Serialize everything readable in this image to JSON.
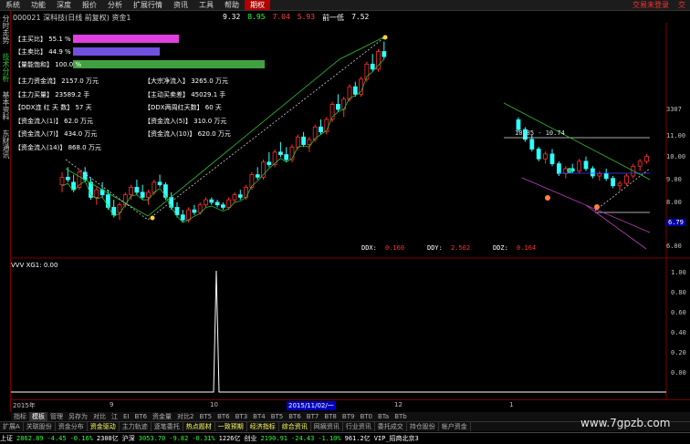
{
  "menu": {
    "items": [
      "系统",
      "功能",
      "深度",
      "报价",
      "分析",
      "扩展行情",
      "资讯",
      "工具",
      "帮助",
      "期权"
    ],
    "active_index": 9,
    "right": [
      "交易未登录",
      "交"
    ]
  },
  "sidebar": {
    "tabs": [
      "分时走势",
      "技术分析",
      "基本资料",
      "东财通讯"
    ],
    "active_index": 1
  },
  "title": {
    "code_name": "000021 深科技(日线 前复权) 资金1",
    "vals": [
      {
        "text": "9.32",
        "color": "#ffffff"
      },
      {
        "text": "8.95",
        "color": "#30ff30"
      },
      {
        "text": "7.04",
        "color": "#ff4040"
      },
      {
        "text": "5.93",
        "color": "#ff4040"
      },
      {
        "text": "前一低",
        "color": "#ffffff"
      },
      {
        "text": "7.52",
        "color": "#ffffff"
      }
    ]
  },
  "flow_bars": [
    {
      "label": "【主买比】 55.1 %",
      "color": "#e040e0",
      "pct": 0.55
    },
    {
      "label": "【主卖比】 44.9 %",
      "color": "#7050e0",
      "pct": 0.45
    },
    {
      "label": "【量能饱和】 100.0 %",
      "color": "#40a040",
      "pct": 1.0
    }
  ],
  "flow_info": [
    [
      "【主力资金流】 2157.0 万元",
      "【大宗净流入】 3265.0 万元"
    ],
    [
      "【主力买量】 23589.2 手",
      "【主动买卖差】 45029.1 手"
    ],
    [
      "【DDX连 红 天 数】 57 天",
      "【DDX两周红天数】 60 天"
    ],
    [
      "【资金流入(1)】 62.0 万元",
      "【资金流入(5)】 310.0 万元"
    ],
    [
      "【资金流入(7)】 434.0 万元",
      "【资金流入(10)】 620.0 万元"
    ],
    [
      "【资金流入(14)】 868.0 万元",
      ""
    ]
  ],
  "price_axis": [
    {
      "text": "3307",
      "hl": false
    },
    {
      "text": "11.00",
      "hl": false
    },
    {
      "text": "10.00",
      "hl": false
    },
    {
      "text": "9.00",
      "hl": false
    },
    {
      "text": "8.00",
      "hl": false
    },
    {
      "text": "6.79",
      "hl": true
    },
    {
      "text": "6.00",
      "hl": false
    }
  ],
  "range_label": "10.85 - 10.74",
  "ddx": [
    {
      "label": "DDX:",
      "value": "0.160"
    },
    {
      "label": "DDY:",
      "value": "2.502"
    },
    {
      "label": "DDZ:",
      "value": "0.164"
    }
  ],
  "indicator": {
    "title": "VVV XG1: 0.00",
    "axis": [
      "1.00",
      "0.80",
      "0.60",
      "0.40",
      "0.20",
      "0.00"
    ]
  },
  "datebar": {
    "year": "2015年",
    "m1": "9",
    "m2": "10",
    "cursor": "2015/11/02/一",
    "m3": "12",
    "m4": "1"
  },
  "tabs1": [
    "指标",
    "模板",
    "管理",
    "另存为",
    "对比",
    "江",
    "EI",
    "BT6",
    "资金量",
    "对比2",
    "BT5",
    "BT6",
    "BT3",
    "BT4",
    "BT5",
    "BT6",
    "BT7",
    "BT8",
    "BT9",
    "BT0",
    "BTa",
    "BTb"
  ],
  "tabs1_sel": 1,
  "tabs2": [
    "扩展A",
    "关联股份",
    "资金分布",
    "资金驱动",
    "主力轨迹",
    "逐笔委托",
    "热点题材",
    "一致预期",
    "经济指标",
    "综合资讯",
    "网摘资讯",
    "行业资讯",
    "委托成交",
    "持仓股份",
    "帐户资金"
  ],
  "tabs2_sel": [
    3,
    6,
    7,
    8,
    9
  ],
  "status": [
    {
      "text": "上证",
      "color": "#ffffff"
    },
    {
      "text": "2862.89",
      "color": "#30ff30"
    },
    {
      "text": "-4.45",
      "color": "#30ff30"
    },
    {
      "text": "-0.16%",
      "color": "#30ff30"
    },
    {
      "text": "2308亿",
      "color": "#ffffff"
    },
    {
      "text": "沪深",
      "color": "#ffffff"
    },
    {
      "text": "3053.70",
      "color": "#30ff30"
    },
    {
      "text": "-9.82",
      "color": "#30ff30"
    },
    {
      "text": "-0.31%",
      "color": "#30ff30"
    },
    {
      "text": "1226亿",
      "color": "#ffffff"
    },
    {
      "text": "创业",
      "color": "#ffffff"
    },
    {
      "text": "2190.91",
      "color": "#30ff30"
    },
    {
      "text": "-24.43",
      "color": "#30ff30"
    },
    {
      "text": "-1.10%",
      "color": "#30ff30"
    },
    {
      "text": "961.2亿",
      "color": "#ffffff"
    },
    {
      "text": "VIP_招商北京3",
      "color": "#ffffff"
    }
  ],
  "watermark": "www.7gpzb.com",
  "colors": {
    "up": "#ff3030",
    "down": "#30ffff",
    "ma": "#30c030",
    "accent": "#b00000"
  },
  "candles": {
    "left": [
      [
        8.9,
        9.4,
        8.6,
        9.2
      ],
      [
        9.2,
        9.6,
        9.0,
        9.1
      ],
      [
        9.0,
        9.3,
        8.6,
        8.7
      ],
      [
        8.8,
        9.5,
        8.7,
        9.4
      ],
      [
        9.4,
        9.6,
        9.0,
        9.1
      ],
      [
        9.0,
        9.2,
        8.3,
        8.4
      ],
      [
        8.4,
        8.8,
        8.1,
        8.7
      ],
      [
        8.7,
        9.0,
        8.4,
        8.5
      ],
      [
        8.5,
        8.7,
        7.9,
        8.0
      ],
      [
        8.0,
        8.3,
        7.6,
        7.7
      ],
      [
        7.8,
        8.2,
        7.5,
        8.1
      ],
      [
        8.1,
        8.6,
        8.0,
        8.5
      ],
      [
        8.5,
        8.9,
        8.3,
        8.8
      ],
      [
        8.8,
        9.1,
        8.5,
        8.6
      ],
      [
        8.6,
        8.9,
        8.3,
        8.4
      ],
      [
        8.4,
        8.7,
        8.1,
        8.6
      ],
      [
        8.6,
        9.1,
        8.5,
        9.0
      ],
      [
        9.0,
        9.3,
        8.8,
        8.9
      ],
      [
        8.9,
        9.0,
        8.3,
        8.4
      ],
      [
        8.4,
        8.6,
        7.9,
        8.0
      ],
      [
        8.0,
        8.2,
        7.6,
        7.7
      ],
      [
        7.7,
        7.9,
        7.4,
        7.5
      ],
      [
        7.5,
        8.0,
        7.4,
        7.9
      ],
      [
        7.9,
        8.1,
        7.7,
        7.8
      ],
      [
        7.8,
        8.2,
        7.7,
        8.1
      ],
      [
        8.1,
        8.4,
        8.0,
        8.3
      ],
      [
        8.3,
        8.4,
        8.1,
        8.2
      ],
      [
        8.2,
        8.3,
        8.0,
        8.1
      ],
      [
        8.1,
        8.2,
        7.9,
        8.0
      ],
      [
        8.0,
        8.4,
        7.9,
        8.3
      ],
      [
        8.3,
        8.6,
        8.2,
        8.5
      ],
      [
        8.5,
        8.7,
        8.3,
        8.4
      ],
      [
        8.4,
        8.9,
        8.3,
        8.8
      ],
      [
        8.8,
        9.4,
        8.7,
        9.3
      ],
      [
        9.3,
        9.6,
        9.1,
        9.2
      ],
      [
        9.2,
        9.9,
        9.1,
        9.8
      ],
      [
        9.8,
        10.2,
        9.6,
        9.7
      ],
      [
        9.7,
        10.3,
        9.6,
        10.2
      ],
      [
        10.2,
        10.6,
        10.0,
        10.1
      ],
      [
        10.1,
        10.4,
        9.8,
        9.9
      ],
      [
        9.9,
        10.5,
        9.8,
        10.4
      ],
      [
        10.4,
        10.9,
        10.3,
        10.8
      ],
      [
        10.8,
        11.0,
        10.4,
        10.5
      ],
      [
        10.5,
        10.8,
        10.2,
        10.7
      ],
      [
        10.7,
        11.3,
        10.6,
        11.2
      ],
      [
        11.2,
        11.5,
        10.9,
        11.0
      ],
      [
        11.0,
        11.6,
        10.9,
        11.5
      ],
      [
        11.5,
        12.2,
        11.4,
        12.1
      ],
      [
        12.1,
        12.5,
        11.8,
        11.9
      ],
      [
        11.9,
        12.4,
        11.6,
        12.3
      ],
      [
        12.3,
        12.9,
        12.2,
        12.8
      ],
      [
        12.8,
        13.0,
        12.4,
        12.5
      ],
      [
        12.5,
        13.2,
        12.4,
        13.1
      ],
      [
        13.1,
        13.8,
        13.0,
        13.7
      ],
      [
        13.7,
        14.1,
        13.4,
        13.5
      ],
      [
        13.5,
        14.3,
        13.4,
        14.2
      ],
      [
        14.2,
        14.6,
        13.9,
        14.0
      ]
    ],
    "right": [
      [
        11.1,
        11.2,
        10.6,
        10.7
      ],
      [
        10.7,
        10.8,
        10.2,
        10.3
      ],
      [
        10.3,
        10.5,
        9.8,
        9.9
      ],
      [
        9.9,
        10.0,
        9.4,
        9.5
      ],
      [
        9.5,
        9.8,
        9.3,
        9.7
      ],
      [
        9.7,
        9.9,
        9.2,
        9.3
      ],
      [
        9.3,
        9.4,
        8.8,
        8.9
      ],
      [
        8.9,
        9.2,
        8.7,
        9.1
      ],
      [
        9.1,
        9.3,
        8.9,
        9.0
      ],
      [
        9.0,
        9.5,
        8.9,
        9.4
      ],
      [
        9.4,
        9.6,
        9.0,
        9.1
      ],
      [
        9.1,
        9.2,
        8.7,
        8.8
      ],
      [
        8.8,
        9.0,
        8.6,
        8.9
      ],
      [
        8.9,
        9.1,
        8.6,
        8.7
      ],
      [
        8.7,
        8.8,
        8.3,
        8.4
      ],
      [
        8.4,
        8.6,
        8.2,
        8.5
      ],
      [
        8.5,
        8.9,
        8.4,
        8.8
      ],
      [
        8.8,
        9.3,
        8.7,
        9.2
      ],
      [
        9.2,
        9.5,
        9.0,
        9.4
      ],
      [
        9.4,
        9.7,
        9.3,
        9.6
      ]
    ]
  }
}
